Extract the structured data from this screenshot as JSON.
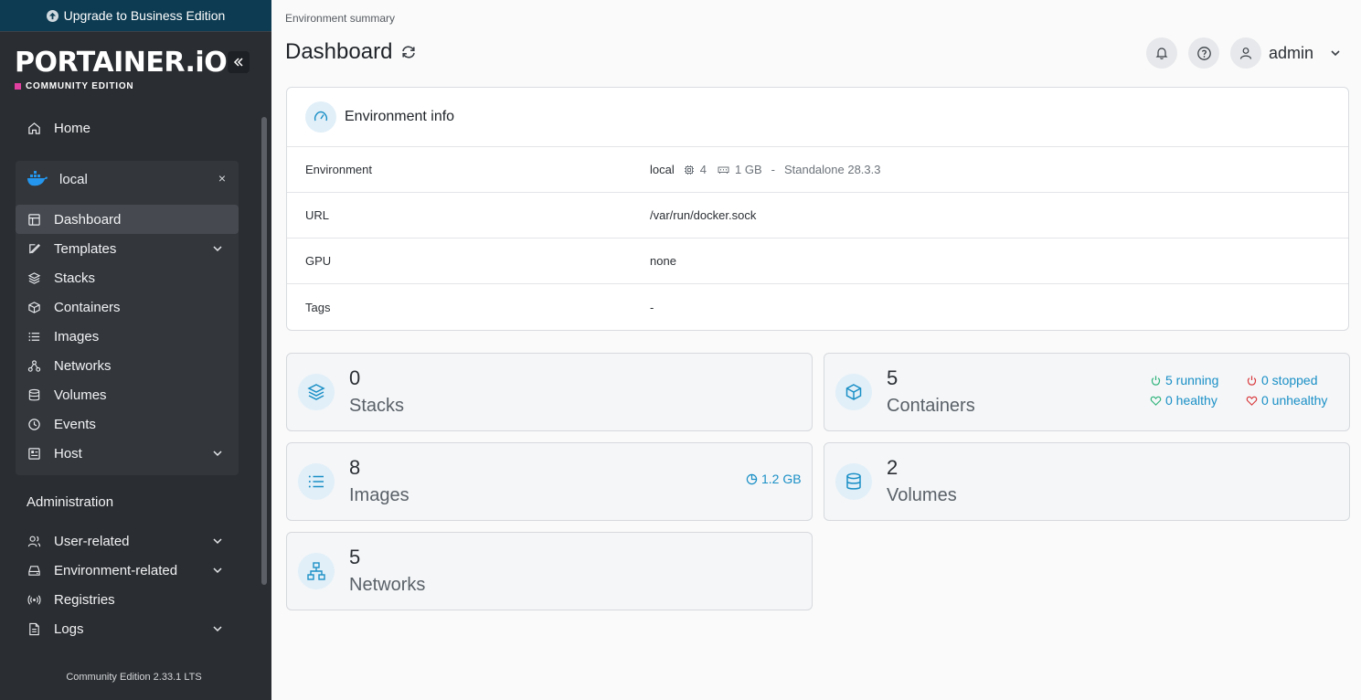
{
  "sidebar": {
    "upgrade_label": "Upgrade to Business Edition",
    "logo_text": "PORTAINER.iO",
    "logo_sub": "COMMUNITY EDITION",
    "home": "Home",
    "environment": {
      "name": "local",
      "close": "×"
    },
    "items": [
      {
        "label": "Dashboard"
      },
      {
        "label": "Templates"
      },
      {
        "label": "Stacks"
      },
      {
        "label": "Containers"
      },
      {
        "label": "Images"
      },
      {
        "label": "Networks"
      },
      {
        "label": "Volumes"
      },
      {
        "label": "Events"
      },
      {
        "label": "Host"
      }
    ],
    "admin_title": "Administration",
    "admin_items": [
      {
        "label": "User-related"
      },
      {
        "label": "Environment-related"
      },
      {
        "label": "Registries"
      },
      {
        "label": "Logs"
      }
    ],
    "version": "Community Edition 2.33.1 LTS"
  },
  "header": {
    "breadcrumb": "Environment summary",
    "title": "Dashboard",
    "user": "admin"
  },
  "env_info": {
    "title": "Environment info",
    "rows": [
      {
        "key": "Environment",
        "name": "local",
        "cpu": "4",
        "mem": "1 GB",
        "sep": "-",
        "type": "Standalone 28.3.3"
      },
      {
        "key": "URL",
        "value": "/var/run/docker.sock"
      },
      {
        "key": "GPU",
        "value": "none"
      },
      {
        "key": "Tags",
        "value": "-"
      }
    ]
  },
  "stats": {
    "stacks": {
      "count": "0",
      "label": "Stacks"
    },
    "containers": {
      "count": "5",
      "label": "Containers",
      "running": "5 running",
      "stopped": "0 stopped",
      "healthy": "0 healthy",
      "unhealthy": "0 unhealthy"
    },
    "images": {
      "count": "8",
      "label": "Images",
      "size": "1.2 GB"
    },
    "volumes": {
      "count": "2",
      "label": "Volumes"
    },
    "networks": {
      "count": "5",
      "label": "Networks"
    }
  },
  "colors": {
    "accent": "#1a8fc6",
    "running": "#2fb37a",
    "stopped": "#d9383b",
    "sidebar": "#2a2d31"
  }
}
